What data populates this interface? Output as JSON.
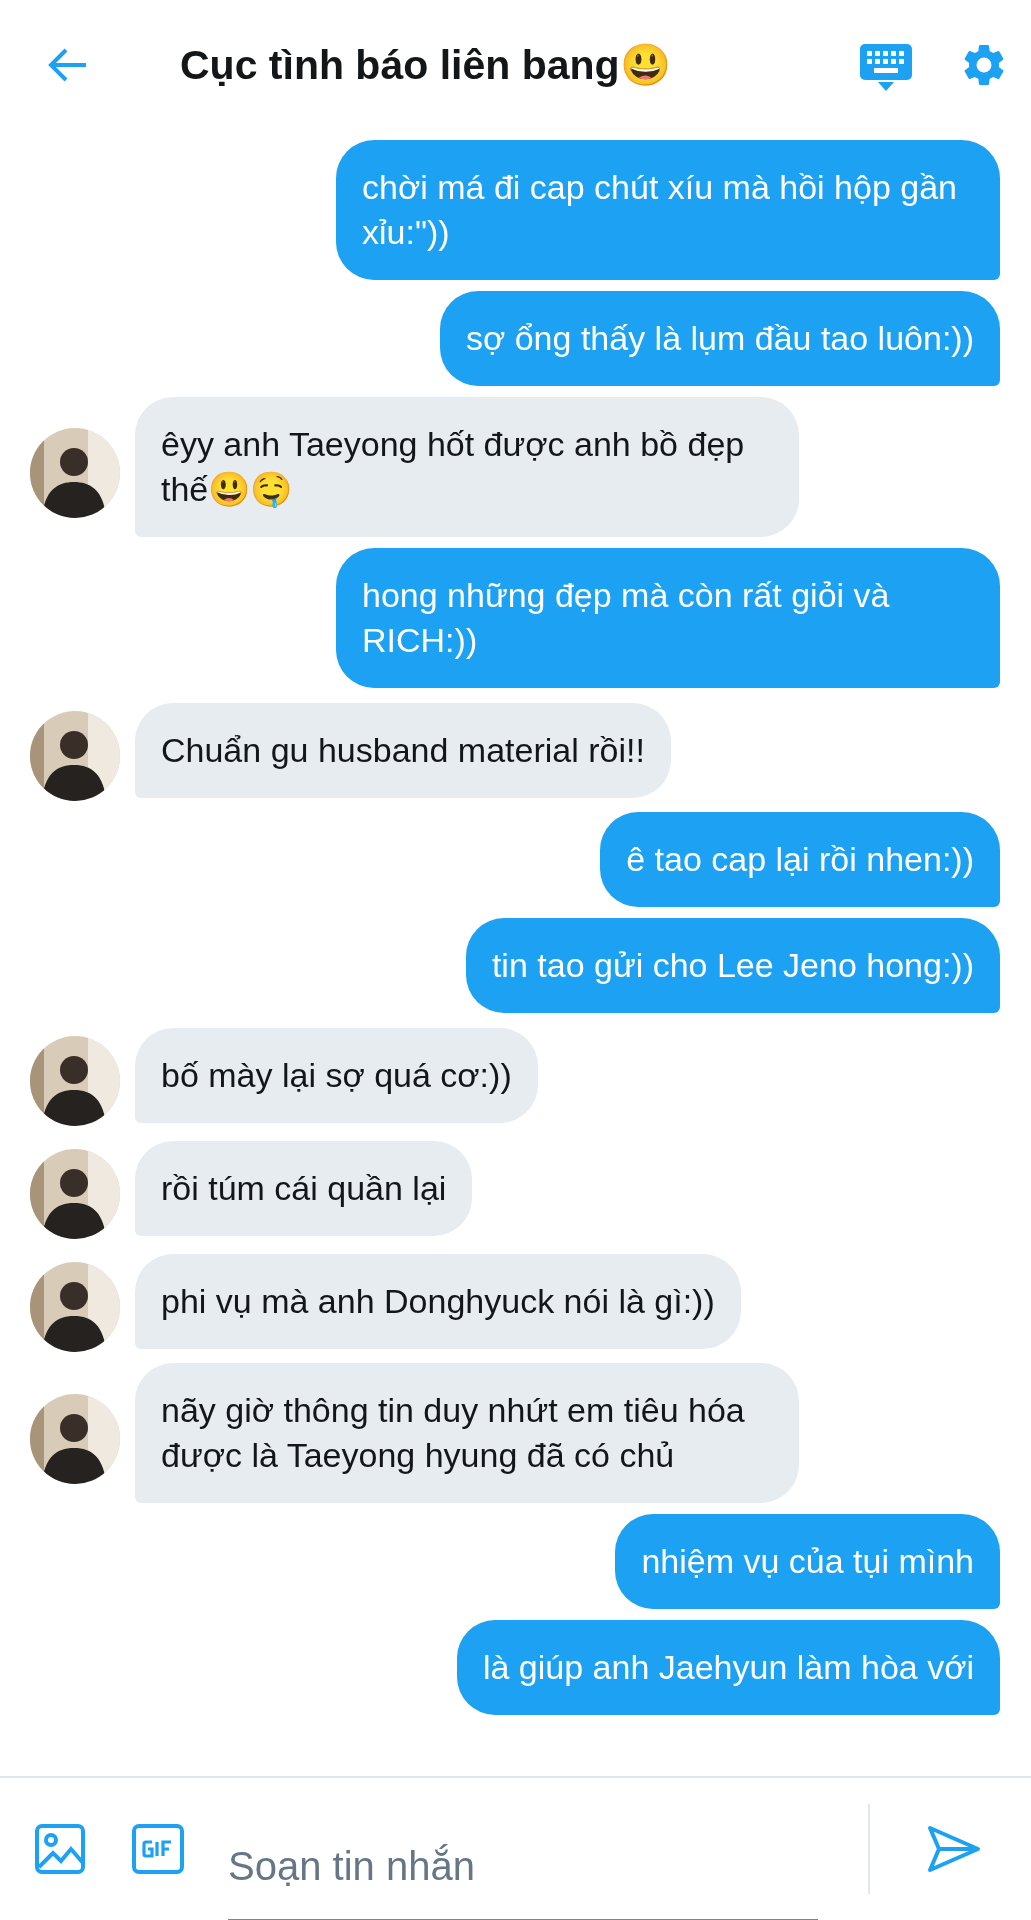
{
  "header": {
    "title": "Cục tình báo liên bang😃"
  },
  "messages": [
    {
      "kind": "outgoing",
      "text": "chời má đi cap chút xíu mà hồi hộp gần xỉu:\"))"
    },
    {
      "kind": "outgoing",
      "text": "sợ ổng thấy là lụm đầu tao luôn:))"
    },
    {
      "kind": "incoming",
      "text": "êyy anh Taeyong hốt được anh bồ đẹp thế😃🤤"
    },
    {
      "kind": "outgoing",
      "text": "hong những đẹp mà còn rất giỏi và RICH:))"
    },
    {
      "kind": "incoming",
      "text": "Chuẩn gu husband material rồi!!"
    },
    {
      "kind": "outgoing",
      "text": "ê tao cap lại rồi nhen:))"
    },
    {
      "kind": "outgoing",
      "text": "tin tao gửi cho Lee Jeno hong:))"
    },
    {
      "kind": "incoming",
      "text": "bố mày lại sợ quá cơ:))"
    },
    {
      "kind": "incoming",
      "text": "rồi túm cái quần lại"
    },
    {
      "kind": "incoming",
      "text": "phi vụ mà anh Donghyuck nói là gì:))"
    },
    {
      "kind": "incoming",
      "text": "nãy giờ thông tin duy nhứt em tiêu hóa được là Taeyong hyung đã có chủ"
    },
    {
      "kind": "outgoing",
      "text": "nhiệm vụ của tụi mình"
    },
    {
      "kind": "outgoing",
      "text": "là giúp anh Jaehyun làm hòa với"
    }
  ],
  "composer": {
    "placeholder": "Soạn tin nhắn"
  }
}
